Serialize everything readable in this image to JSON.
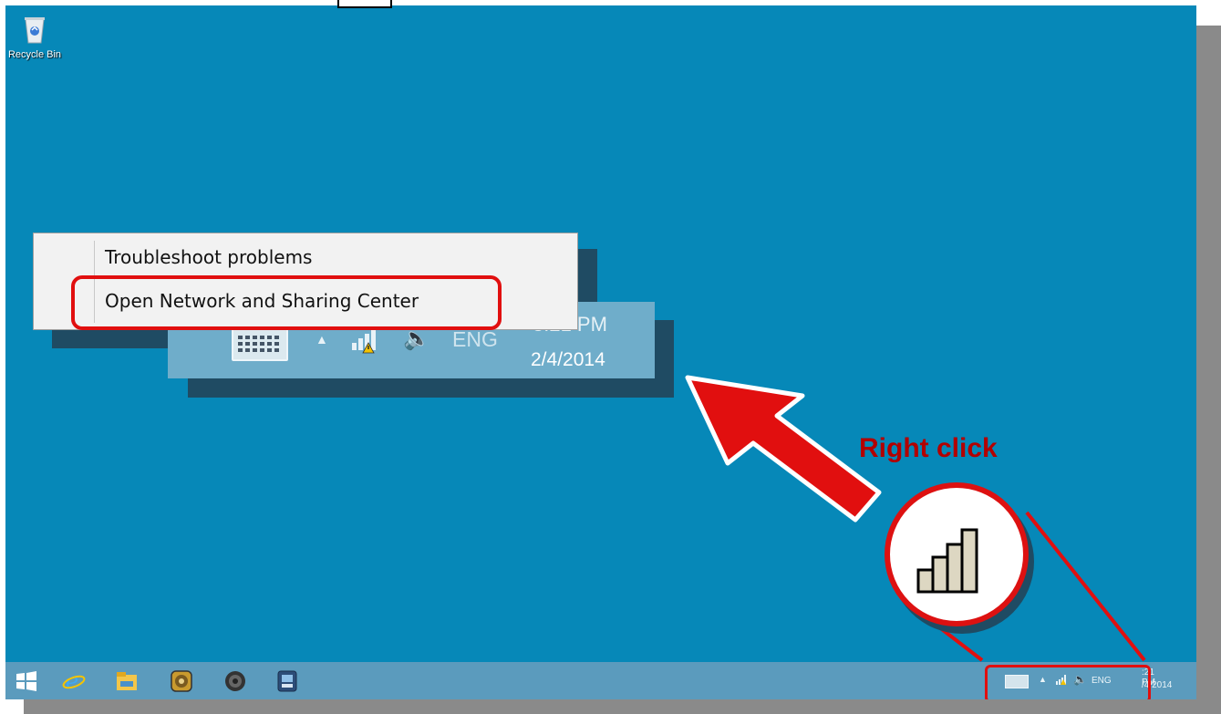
{
  "desktop": {
    "background_color": "#0688b8",
    "recycle_bin_label": "Recycle Bin"
  },
  "context_menu": {
    "items": [
      {
        "label": "Troubleshoot problems"
      },
      {
        "label": "Open Network and Sharing Center",
        "highlighted": true
      }
    ]
  },
  "tray_zoom": {
    "language": "ENG",
    "time": "3:21 PM",
    "date": "2/4/2014"
  },
  "annotation": {
    "instruction": "Right click",
    "accent_color": "#e10f0f"
  },
  "taskbar": {
    "apps": [
      "start-icon",
      "internet-explorer-icon",
      "file-explorer-icon",
      "media-player-icon",
      "speaker-app-icon",
      "document-app-icon"
    ],
    "tray": {
      "language": "ENG",
      "time": ":21 PM",
      "date": "/4/2014"
    }
  }
}
